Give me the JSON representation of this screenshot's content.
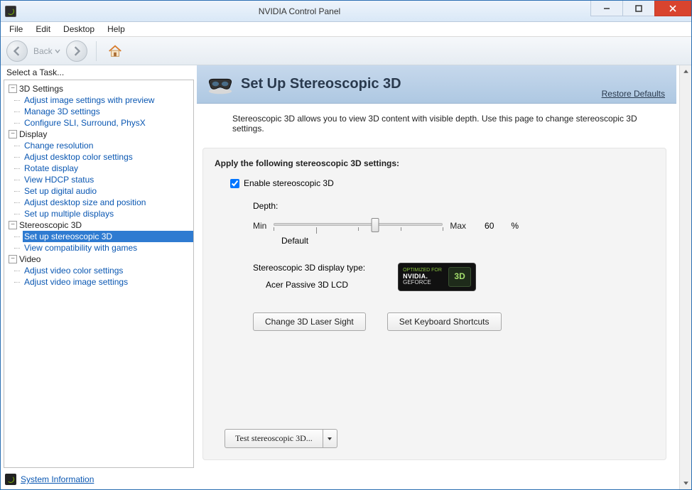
{
  "window": {
    "title": "NVIDIA Control Panel"
  },
  "menubar": [
    "File",
    "Edit",
    "Desktop",
    "Help"
  ],
  "toolbar": {
    "back_label": "Back"
  },
  "sidebar": {
    "head": "Select a Task...",
    "groups": [
      {
        "label": "3D Settings",
        "items": [
          "Adjust image settings with preview",
          "Manage 3D settings",
          "Configure SLI, Surround, PhysX"
        ]
      },
      {
        "label": "Display",
        "items": [
          "Change resolution",
          "Adjust desktop color settings",
          "Rotate display",
          "View HDCP status",
          "Set up digital audio",
          "Adjust desktop size and position",
          "Set up multiple displays"
        ]
      },
      {
        "label": "Stereoscopic 3D",
        "items": [
          "Set up stereoscopic 3D",
          "View compatibility with games"
        ],
        "selectedIndex": 0
      },
      {
        "label": "Video",
        "items": [
          "Adjust video color settings",
          "Adjust video image settings"
        ]
      }
    ],
    "sysinfo": "System Information"
  },
  "page": {
    "title": "Set Up Stereoscopic 3D",
    "restore": "Restore Defaults",
    "description": "Stereoscopic 3D allows you to view 3D content with visible depth. Use this page to change stereoscopic 3D settings.",
    "section_title": "Apply the following stereoscopic 3D settings:",
    "enable_label": "Enable stereoscopic 3D",
    "enable_checked": true,
    "depth": {
      "label": "Depth:",
      "min": "Min",
      "max": "Max",
      "value": "60",
      "pct": "%",
      "default": "Default"
    },
    "display_type": {
      "label": "Stereoscopic 3D display type:",
      "value": "Acer Passive 3D LCD",
      "badge_top": "OPTIMIZED FOR",
      "badge_logo": "NVIDIA.",
      "badge_gf": "GEFORCE",
      "badge_3d": "3D"
    },
    "btn_laser": "Change 3D Laser Sight",
    "btn_keys": "Set Keyboard Shortcuts",
    "btn_test": "Test stereoscopic 3D..."
  }
}
